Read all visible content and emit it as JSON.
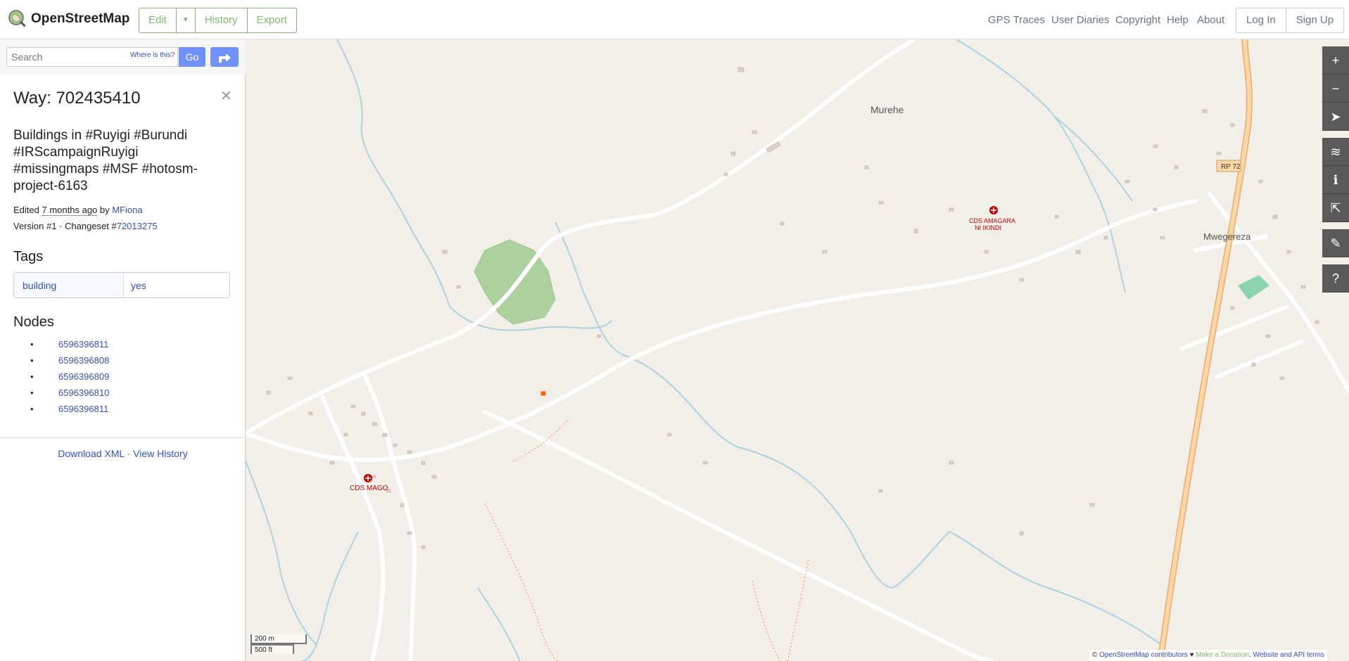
{
  "header": {
    "brand": "OpenStreetMap",
    "edit_label": "Edit",
    "history_label": "History",
    "export_label": "Export",
    "nav": [
      "GPS Traces",
      "User Diaries",
      "Copyright",
      "Help",
      "About"
    ],
    "login_label": "Log In",
    "signup_label": "Sign Up"
  },
  "search": {
    "placeholder": "Search",
    "where_label": "Where is this?",
    "go_label": "Go"
  },
  "feature": {
    "title": "Way: 702435410",
    "description": "Buildings in #Ruyigi #Burundi #IRScampaignRuyigi #missingmaps #MSF #hotosm-project-6163",
    "edited_prefix": "Edited",
    "edited_time": "7 months ago",
    "by_label": "by",
    "user": "MFiona",
    "version_label": "Version #1 · Changeset #",
    "changeset": "72013275",
    "tags_heading": "Tags",
    "tags": [
      {
        "key": "building",
        "value": "yes"
      }
    ],
    "nodes_heading": "Nodes",
    "nodes": [
      "6596396811",
      "6596396808",
      "6596396809",
      "6596396810",
      "6596396811"
    ],
    "download_xml": "Download XML",
    "separator": "·",
    "view_history": "View History"
  },
  "map": {
    "places": {
      "murehe": "Murehe",
      "mwegereza": "Mwegereza",
      "cds_amagara_1": "CDS AMAGARA",
      "cds_amagara_2": "NI IKINDI",
      "cds_mago": "CDS MAGO",
      "road_ref": "RP 72"
    },
    "scale_metric": "200 m",
    "scale_imperial": "500 ft",
    "attribution": {
      "copyright": "©",
      "contributors": "OpenStreetMap contributors",
      "heart": "♥",
      "donate": "Make a Donation",
      "terms": "Website and API terms"
    },
    "colors": {
      "land": "#f2efe9",
      "water": "#aad3df",
      "forest": "#add19e",
      "primary_road": "#fcd6a4",
      "building": "#d9d0c9",
      "hospital": "#bf0000"
    }
  },
  "controls": [
    "zoom-in",
    "zoom-out",
    "locate",
    "layers",
    "map-key",
    "share",
    "add-note",
    "query-features"
  ]
}
